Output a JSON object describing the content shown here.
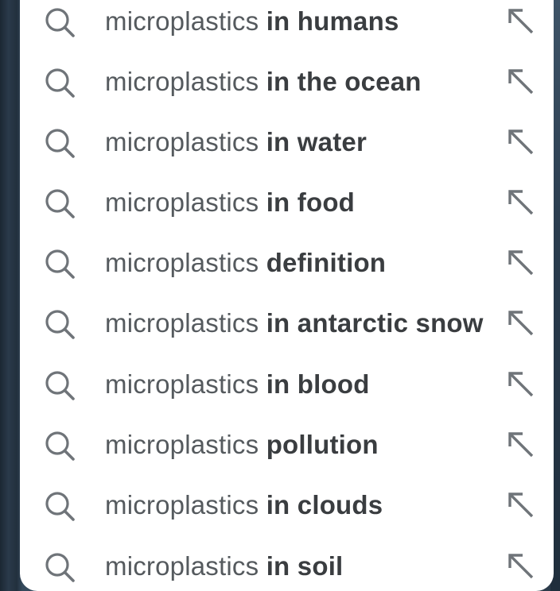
{
  "suggestions": [
    {
      "prefix": "microplastics",
      "completion": "in humans"
    },
    {
      "prefix": "microplastics",
      "completion": "in the ocean"
    },
    {
      "prefix": "microplastics",
      "completion": "in water"
    },
    {
      "prefix": "microplastics",
      "completion": "in food"
    },
    {
      "prefix": "microplastics",
      "completion": "definition"
    },
    {
      "prefix": "microplastics",
      "completion": "in antarctic snow"
    },
    {
      "prefix": "microplastics",
      "completion": "in blood"
    },
    {
      "prefix": "microplastics",
      "completion": "pollution"
    },
    {
      "prefix": "microplastics",
      "completion": "in clouds"
    },
    {
      "prefix": "microplastics",
      "completion": "in soil"
    }
  ],
  "icons": {
    "leading": "search-icon",
    "trailing": "fill-query-arrow-icon"
  },
  "colors": {
    "icon": "#6f7479",
    "prefix_text": "#555a5e",
    "completion_text": "#3a3d40",
    "panel": "#ffffff"
  }
}
